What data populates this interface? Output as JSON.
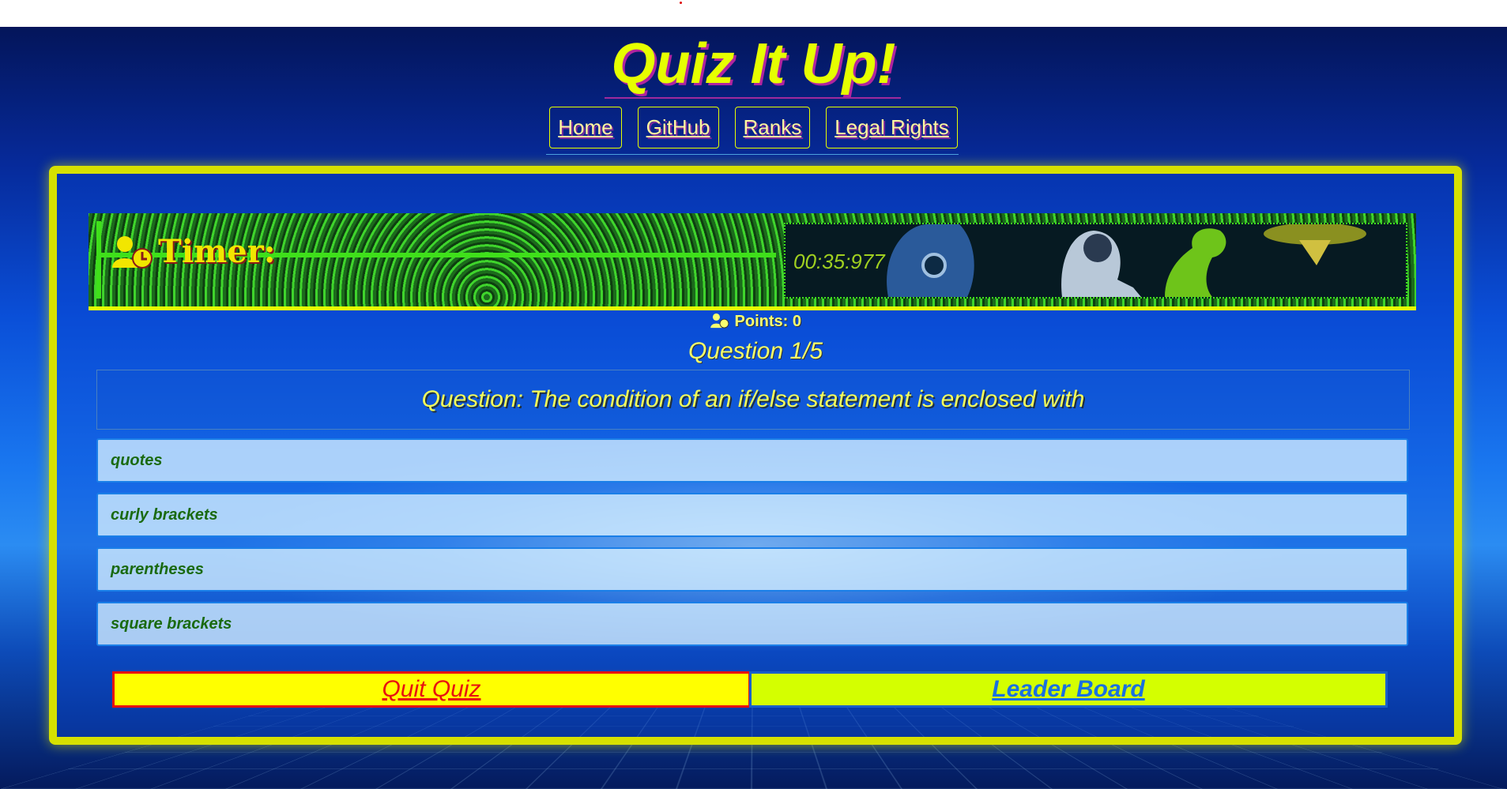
{
  "app": {
    "title": "Quiz It Up!"
  },
  "nav": {
    "items": [
      "Home",
      "GitHub",
      "Ranks",
      "Legal Rights"
    ]
  },
  "timer": {
    "label": "Timer:",
    "value": "00:35:977"
  },
  "score": {
    "points": "Points: 0"
  },
  "quiz": {
    "progress": "Question 1/5",
    "question": "Question: The condition of an if/else statement is enclosed with",
    "answers": [
      "quotes",
      "curly brackets",
      "parentheses",
      "square brackets"
    ]
  },
  "buttons": {
    "quit": "Quit Quiz",
    "leaderboard": "Leader Board"
  },
  "colors": {
    "accent": "#e6ff00",
    "quit_bg": "#ffff00",
    "leader_bg": "#d4ff00",
    "answer_text": "#1a6a10"
  }
}
